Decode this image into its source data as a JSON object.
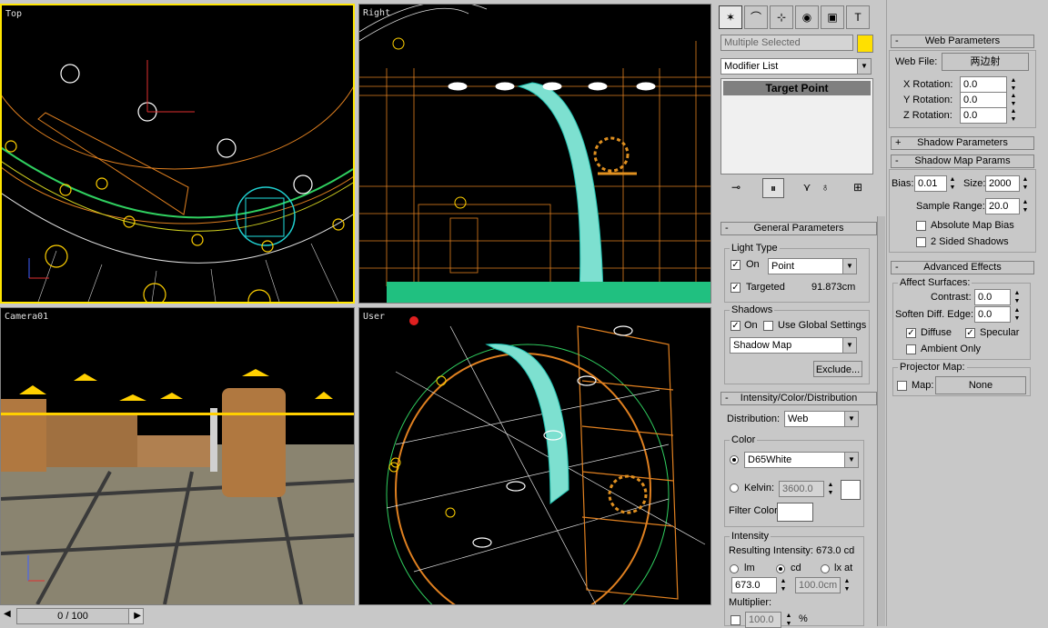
{
  "viewports": {
    "top_label": "Top",
    "right_label": "Right",
    "camera_label": "Camera01",
    "user_label": "User"
  },
  "timeline": {
    "frame": "0 / 100"
  },
  "command_panel": {
    "object_name": "Multiple Selected",
    "object_color": "#ffe000",
    "modifier_list": "Modifier List",
    "stack_item": "Target Point",
    "general": {
      "title": "General Parameters",
      "light_type_group": "Light Type",
      "on_label": "On",
      "type_value": "Point",
      "targeted_label": "Targeted",
      "targeted_distance": "91.873cm",
      "shadows_group": "Shadows",
      "shadows_on_label": "On",
      "use_global_label": "Use Global Settings",
      "shadow_type": "Shadow Map",
      "exclude_label": "Exclude..."
    },
    "intensity": {
      "title": "Intensity/Color/Distribution",
      "distribution_label": "Distribution:",
      "distribution_value": "Web",
      "color_group": "Color",
      "color_preset": "D65White",
      "kelvin_label": "Kelvin:",
      "kelvin_value": "3600.0",
      "filter_label": "Filter Color:",
      "intensity_group": "Intensity",
      "resulting_label": "Resulting Intensity:",
      "resulting_value": "673.0 cd",
      "unit_lm": "lm",
      "unit_cd": "cd",
      "unit_lx": "lx at",
      "intensity_value": "673.0",
      "lx_distance": "100.0cm",
      "multiplier_label": "Multiplier:",
      "multiplier_value": "100.0",
      "percent": "%"
    }
  },
  "side_panel": {
    "web_title": "Web Parameters",
    "web_file_label": "Web File:",
    "web_file_value": "两边射",
    "x_rot_label": "X Rotation:",
    "x_rot": "0.0",
    "y_rot_label": "Y Rotation:",
    "y_rot": "0.0",
    "z_rot_label": "Z Rotation:",
    "z_rot": "0.0",
    "shadow_params_title": "Shadow Parameters",
    "shadow_map_title": "Shadow Map Params",
    "bias_label": "Bias:",
    "bias": "0.01",
    "size_label": "Size:",
    "size": "2000",
    "sample_label": "Sample Range:",
    "sample": "20.0",
    "abs_bias_label": "Absolute Map Bias",
    "two_sided_label": "2 Sided Shadows",
    "adv_title": "Advanced Effects",
    "affect_group": "Affect Surfaces:",
    "contrast_label": "Contrast:",
    "contrast": "0.0",
    "soften_label": "Soften Diff. Edge:",
    "soften": "0.0",
    "diffuse_label": "Diffuse",
    "specular_label": "Specular",
    "ambient_label": "Ambient Only",
    "projector_group": "Projector Map:",
    "map_label": "Map:",
    "map_value": "None"
  }
}
